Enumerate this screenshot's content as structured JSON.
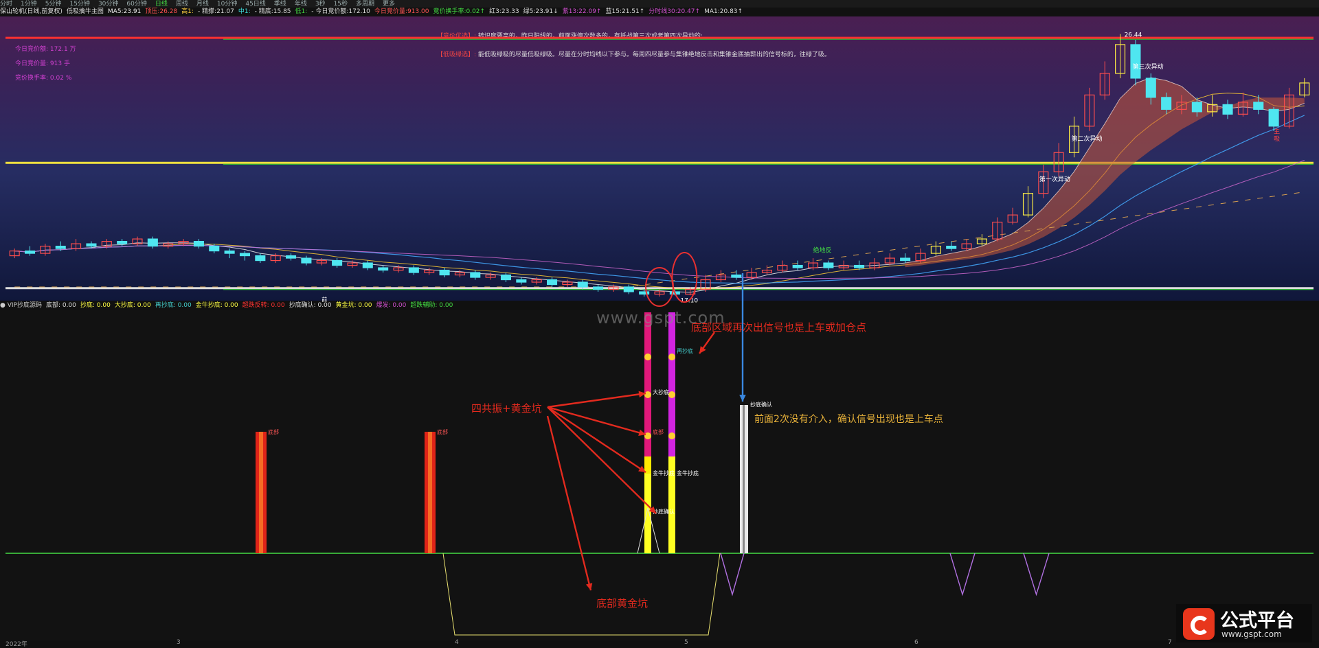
{
  "tabs": [
    "分时",
    "1分钟",
    "5分钟",
    "15分钟",
    "30分钟",
    "60分钟",
    "日线",
    "周线",
    "月线",
    "10分钟",
    "45日线",
    "季线",
    "年线",
    "3秒",
    "15秒",
    "多周期",
    "更多"
  ],
  "info_bar": {
    "title": "保山轮机(日线,前复权)",
    "indicator": "低吸擒牛主图",
    "items": [
      {
        "label": "MA5:",
        "value": "23.91",
        "color": "#eeeeee"
      },
      {
        "label": "顶压:",
        "value": "26.28",
        "color": "#ff5050"
      },
      {
        "label": "高1:",
        "value": "",
        "color": "#ffd040"
      },
      {
        "label": "- 精撑:",
        "value": "21.07",
        "color": "#dddddd"
      },
      {
        "label": "中1:",
        "value": "",
        "color": "#40e0e0"
      },
      {
        "label": "- 精底:",
        "value": "15.85",
        "color": "#dddddd"
      },
      {
        "label": "低1:",
        "value": "",
        "color": "#40d040"
      },
      {
        "label": "- 今日竞价额:",
        "value": "172.10",
        "color": "#dddddd"
      },
      {
        "label": "今日竞价量:",
        "value": "913.00",
        "color": "#ff5555"
      },
      {
        "label": "竞价换手率:",
        "value": "0.02↑",
        "color": "#44dd44"
      },
      {
        "label": "红3:",
        "value": "23.33",
        "color": "#dddddd"
      },
      {
        "label": "绿5:",
        "value": "23.91↓",
        "color": "#dddddd"
      },
      {
        "label": "紫13:",
        "value": "22.09↑",
        "color": "#d050d0"
      },
      {
        "label": "蓝15:",
        "value": "21.51↑",
        "color": "#dddddd"
      },
      {
        "label": "分时线30:",
        "value": "20.47↑",
        "color": "#d050d0"
      },
      {
        "label": "MA1:",
        "value": "20.83↑",
        "color": "#dddddd"
      }
    ]
  },
  "legend": [
    {
      "label": "今日竞价额:",
      "value": "172.1",
      "unit": "万"
    },
    {
      "label": "今日竞价量:",
      "value": "913",
      "unit": "手"
    },
    {
      "label": "竞价换手率:",
      "value": "0.02",
      "unit": "%"
    }
  ],
  "notes": [
    {
      "tag": "【竞价优选】:",
      "text": "转识度要高的，昨日阳线的，前面涨停次数多的，有抵战第三次或者第四次异动的;"
    },
    {
      "tag": "【低吸绿选】:",
      "text": "能低吸绿吸的尽量低吸绿吸。尽量在分时均线以下参与。每周四尽量参与集锥绝地反击和集锥金底抽薪出的信号标的，往绿了吸。"
    }
  ],
  "chart_labels": {
    "ann_first": "第一次异动",
    "ann_second": "第二次异动",
    "ann_third": "第三次异动",
    "peak": "26.44",
    "trough": "17.10",
    "mark_jue": "绝地反",
    "mark_zhu": "主",
    "mark_xi": "吸",
    "mark_shi": "阻",
    "mark_qian": "前"
  },
  "sub_header": {
    "name": "VIP抄底源码",
    "items": [
      {
        "label": "底部:",
        "value": "0.00",
        "color": "#dddddd"
      },
      {
        "label": "抄底:",
        "value": "0.00",
        "color": "#ffff44"
      },
      {
        "label": "大抄底:",
        "value": "0.00",
        "color": "#ffff44"
      },
      {
        "label": "再抄底:",
        "value": "0.00",
        "color": "#44cccc"
      },
      {
        "label": "金牛抄底:",
        "value": "0.00",
        "color": "#ffff44"
      },
      {
        "label": "超跌反转:",
        "value": "0.00",
        "color": "#ff3333"
      },
      {
        "label": "抄底确认:",
        "value": "0.00",
        "color": "#dddddd"
      },
      {
        "label": "黄金坑:",
        "value": "0.00",
        "color": "#ffff44"
      },
      {
        "label": "爆发:",
        "value": "0.00",
        "color": "#d050d0"
      },
      {
        "label": "超跌辅助:",
        "value": "0.00",
        "color": "#44dd44"
      }
    ]
  },
  "signal_labels": {
    "di_bu": "底部",
    "zai_chao_di": "再抄底",
    "da_chao_di": "大抄底",
    "jin_niu": "金牛抄底",
    "jin_niu_b": "金牛抄底",
    "chao_di_q": "抄底确认",
    "chao_di_qs": "抄底确认",
    "di_bu2": "底部"
  },
  "annotations": {
    "resonance": "四共振+黄金坑",
    "bottom_zone": "底部区域再次出信号也是上车或加仓点",
    "confirm": "前面2次没有介入，确认信号出现也是上车点",
    "gold_pit": "底部黄金坑"
  },
  "watermark": "www.gspt.com",
  "brand": {
    "name": "公式平台",
    "url": "www.gspt.com"
  },
  "x_axis": [
    "2022年",
    "3",
    "4",
    "5",
    "6",
    "7"
  ],
  "chart_data": {
    "type": "candlestick",
    "title": "保山轮机(日线,前复权)",
    "ylim": [
      15.5,
      27.0
    ],
    "levels": [
      {
        "name": "顶压",
        "value": 26.28,
        "color": "#ff3030"
      },
      {
        "name": "精撑",
        "value": 21.07,
        "color": "#f0e040"
      },
      {
        "name": "精底",
        "value": 15.85,
        "color": "#dddddd"
      }
    ],
    "candles": [
      [
        17.2,
        17.4,
        17.5,
        17.1
      ],
      [
        17.4,
        17.3,
        17.6,
        17.2
      ],
      [
        17.3,
        17.6,
        17.7,
        17.2
      ],
      [
        17.6,
        17.5,
        17.8,
        17.4
      ],
      [
        17.5,
        17.7,
        17.9,
        17.4
      ],
      [
        17.7,
        17.6,
        17.8,
        17.5
      ],
      [
        17.6,
        17.8,
        17.9,
        17.5
      ],
      [
        17.8,
        17.7,
        17.9,
        17.6
      ],
      [
        17.7,
        17.9,
        18.0,
        17.6
      ],
      [
        17.9,
        17.6,
        18.0,
        17.5
      ],
      [
        17.6,
        17.7,
        17.8,
        17.5
      ],
      [
        17.7,
        17.8,
        17.9,
        17.6
      ],
      [
        17.8,
        17.6,
        17.9,
        17.5
      ],
      [
        17.6,
        17.4,
        17.7,
        17.3
      ],
      [
        17.4,
        17.3,
        17.5,
        17.1
      ],
      [
        17.3,
        17.2,
        17.4,
        17.0
      ],
      [
        17.2,
        17.0,
        17.3,
        16.9
      ],
      [
        17.0,
        17.2,
        17.3,
        16.9
      ],
      [
        17.2,
        17.1,
        17.3,
        17.0
      ],
      [
        17.1,
        16.9,
        17.2,
        16.8
      ],
      [
        16.9,
        17.0,
        17.1,
        16.8
      ],
      [
        17.0,
        16.8,
        17.1,
        16.7
      ],
      [
        16.8,
        16.9,
        17.0,
        16.7
      ],
      [
        16.9,
        16.7,
        17.0,
        16.6
      ],
      [
        16.7,
        16.6,
        16.8,
        16.5
      ],
      [
        16.6,
        16.7,
        16.8,
        16.5
      ],
      [
        16.7,
        16.5,
        16.8,
        16.4
      ],
      [
        16.5,
        16.6,
        16.7,
        16.4
      ],
      [
        16.6,
        16.4,
        16.7,
        16.3
      ],
      [
        16.4,
        16.5,
        16.6,
        16.3
      ],
      [
        16.5,
        16.3,
        16.6,
        16.2
      ],
      [
        16.3,
        16.4,
        16.5,
        16.2
      ],
      [
        16.4,
        16.2,
        16.5,
        16.1
      ],
      [
        16.2,
        16.1,
        16.3,
        16.0
      ],
      [
        16.1,
        16.2,
        16.3,
        16.0
      ],
      [
        16.2,
        16.0,
        16.3,
        15.9
      ],
      [
        16.0,
        16.1,
        16.2,
        15.9
      ],
      [
        16.1,
        15.9,
        16.2,
        15.8
      ],
      [
        15.9,
        15.8,
        16.0,
        15.7
      ],
      [
        15.8,
        15.9,
        16.0,
        15.7
      ],
      [
        15.9,
        15.7,
        16.0,
        15.6
      ],
      [
        15.7,
        15.6,
        15.8,
        15.5
      ],
      [
        15.6,
        15.7,
        15.8,
        15.5
      ],
      [
        15.7,
        15.6,
        15.8,
        15.55
      ],
      [
        15.6,
        15.8,
        15.9,
        15.55
      ],
      [
        15.8,
        16.2,
        16.4,
        15.7
      ],
      [
        16.2,
        16.4,
        16.6,
        16.1
      ],
      [
        16.4,
        16.3,
        16.6,
        16.2
      ],
      [
        16.3,
        16.5,
        16.7,
        16.2
      ],
      [
        16.5,
        16.6,
        16.8,
        16.4
      ],
      [
        16.6,
        16.8,
        17.0,
        16.5
      ],
      [
        16.8,
        16.7,
        17.0,
        16.6
      ],
      [
        16.7,
        16.9,
        17.1,
        16.6
      ],
      [
        16.9,
        16.7,
        17.0,
        16.6
      ],
      [
        16.7,
        16.8,
        17.0,
        16.6
      ],
      [
        16.8,
        16.7,
        17.0,
        16.6
      ],
      [
        16.7,
        16.9,
        17.1,
        16.6
      ],
      [
        16.9,
        17.1,
        17.3,
        16.8
      ],
      [
        17.1,
        17.0,
        17.3,
        16.9
      ],
      [
        17.0,
        17.3,
        17.5,
        16.9
      ],
      [
        17.3,
        17.6,
        17.8,
        17.2
      ],
      [
        17.6,
        17.5,
        17.8,
        17.4
      ],
      [
        17.5,
        17.7,
        17.9,
        17.4
      ],
      [
        17.7,
        17.9,
        18.1,
        17.6
      ],
      [
        17.9,
        18.6,
        18.8,
        17.8
      ],
      [
        18.6,
        18.9,
        19.2,
        18.5
      ],
      [
        18.9,
        19.8,
        20.1,
        18.8
      ],
      [
        19.8,
        20.7,
        21.0,
        19.6
      ],
      [
        20.7,
        21.5,
        21.9,
        20.5
      ],
      [
        21.5,
        22.6,
        23.0,
        21.3
      ],
      [
        22.6,
        23.9,
        24.2,
        22.4
      ],
      [
        23.9,
        24.8,
        25.3,
        23.7
      ],
      [
        24.8,
        26.0,
        26.44,
        24.6
      ],
      [
        26.0,
        24.6,
        26.2,
        24.3
      ],
      [
        24.6,
        23.8,
        24.8,
        23.5
      ],
      [
        23.8,
        23.3,
        24.0,
        23.1
      ],
      [
        23.3,
        23.6,
        23.9,
        23.1
      ],
      [
        23.6,
        23.2,
        23.8,
        23.0
      ],
      [
        23.2,
        23.5,
        23.9,
        23.0
      ],
      [
        23.5,
        23.1,
        23.7,
        22.9
      ],
      [
        23.1,
        23.6,
        24.0,
        23.0
      ],
      [
        23.6,
        23.3,
        23.9,
        23.1
      ],
      [
        23.3,
        22.6,
        23.4,
        22.4
      ],
      [
        22.6,
        23.9,
        24.2,
        22.5
      ],
      [
        23.9,
        24.4,
        24.6,
        23.8
      ]
    ],
    "signals": {
      "di_bu": [
        5,
        12
      ],
      "resonance": [
        24,
        25
      ],
      "confirm": 27,
      "gold_pit": [
        17,
        26
      ],
      "explosion": [
        27,
        37,
        40
      ]
    }
  }
}
